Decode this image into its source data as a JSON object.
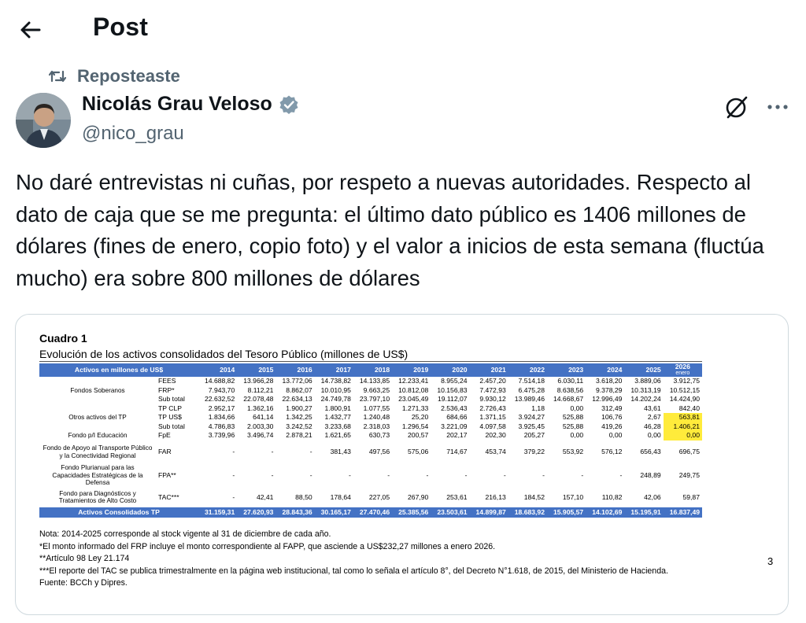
{
  "header": {
    "title": "Post"
  },
  "repost": {
    "label": "Reposteaste"
  },
  "author": {
    "name": "Nicolás Grau Veloso",
    "handle": "@nico_grau"
  },
  "tweet": {
    "text": "No daré entrevistas ni cuñas, por respeto a nuevas autoridades. Respecto al dato de caja que se me pregunta: el último dato público es 1406 millones de dólares (fines de enero, copio foto) y el valor a inicios de esta semana (fluctúa mucho) era sobre 800 millones de dólares"
  },
  "colors": {
    "accent": "#1d9bf0",
    "table_header": "#4472c4",
    "highlight": "#ffeb3b",
    "muted": "#536471"
  },
  "icons": [
    "back-arrow-icon",
    "repost-icon",
    "verified-badge-icon",
    "grok-icon",
    "more-icon"
  ],
  "document": {
    "title": "Cuadro 1",
    "subtitle": "Evolución de los activos consolidados del Tesoro Público (millones de US$)",
    "table": {
      "header_label": "Activos en millones de US$",
      "years": [
        "2014",
        "2015",
        "2016",
        "2017",
        "2018",
        "2019",
        "2020",
        "2021",
        "2022",
        "2023",
        "2024",
        "2025",
        "2026"
      ],
      "last_col_sub": "enero",
      "rows": [
        {
          "group": "Fondos Soberanos",
          "item": "FEES",
          "values": [
            "14.688,82",
            "13.966,28",
            "13.772,06",
            "14.738,82",
            "14.133,85",
            "12.233,41",
            "8.955,24",
            "2.457,20",
            "7.514,18",
            "6.030,11",
            "3.618,20",
            "3.889,06",
            "3.912,75"
          ]
        },
        {
          "group": "",
          "item": "FRP*",
          "values": [
            "7.943,70",
            "8.112,21",
            "8.862,07",
            "10.010,95",
            "9.663,25",
            "10.812,08",
            "10.156,83",
            "7.472,93",
            "6.475,28",
            "8.638,56",
            "9.378,29",
            "10.313,19",
            "10.512,15"
          ]
        },
        {
          "group": "",
          "item": "Sub total",
          "values": [
            "22.632,52",
            "22.078,48",
            "22.634,13",
            "24.749,78",
            "23.797,10",
            "23.045,49",
            "19.112,07",
            "9.930,12",
            "13.989,46",
            "14.668,67",
            "12.996,49",
            "14.202,24",
            "14.424,90"
          ]
        },
        {
          "group": "Otros activos del TP",
          "item": "TP CLP",
          "values": [
            "2.952,17",
            "1.362,16",
            "1.900,27",
            "1.800,91",
            "1.077,55",
            "1.271,33",
            "2.536,43",
            "2.726,43",
            "1,18",
            "0,00",
            "312,49",
            "43,61",
            "842,40"
          ]
        },
        {
          "group": "",
          "item": "TP US$",
          "values": [
            "1.834,66",
            "641,14",
            "1.342,25",
            "1.432,77",
            "1.240,48",
            "25,20",
            "684,66",
            "1.371,15",
            "3.924,27",
            "525,88",
            "106,76",
            "2,67",
            "563,81"
          ]
        },
        {
          "group": "",
          "item": "Sub total",
          "values": [
            "4.786,83",
            "2.003,30",
            "3.242,52",
            "3.233,68",
            "2.318,03",
            "1.296,54",
            "3.221,09",
            "4.097,58",
            "3.925,45",
            "525,88",
            "419,26",
            "46,28",
            "1.406,21"
          ]
        },
        {
          "group": "Fondo p/I Educación",
          "item": "FpE",
          "values": [
            "3.739,96",
            "3.496,74",
            "2.878,21",
            "1.621,65",
            "630,73",
            "200,57",
            "202,17",
            "202,30",
            "205,27",
            "0,00",
            "0,00",
            "0,00",
            "0,00"
          ]
        },
        {
          "group": "Fondo de Apoyo al Transporte Público y la Conectividad Regional",
          "item": "FAR",
          "values": [
            "-",
            "-",
            "-",
            "381,43",
            "497,56",
            "575,06",
            "714,67",
            "453,74",
            "379,22",
            "553,92",
            "576,12",
            "656,43",
            "696,75"
          ]
        },
        {
          "group": "Fondo Plurianual para las Capacidades Estratégicas de la Defensa",
          "item": "FPA**",
          "values": [
            "-",
            "-",
            "-",
            "-",
            "-",
            "-",
            "-",
            "-",
            "-",
            "-",
            "-",
            "248,89",
            "249,75"
          ]
        },
        {
          "group": "Fondo para Diagnósticos y Tratamientos de Alto Costo",
          "item": "TAC***",
          "values": [
            "-",
            "42,41",
            "88,50",
            "178,64",
            "227,05",
            "267,90",
            "253,61",
            "216,13",
            "184,52",
            "157,10",
            "110,82",
            "42,06",
            "59,87"
          ]
        }
      ],
      "total": {
        "label": "Activos Consolidados TP",
        "values": [
          "31.159,31",
          "27.620,93",
          "28.843,36",
          "30.165,17",
          "27.470,46",
          "25.385,56",
          "23.503,61",
          "14.899,87",
          "18.683,92",
          "15.905,57",
          "14.102,69",
          "15.195,91",
          "16.837,49"
        ]
      }
    },
    "notes": [
      "Nota: 2014-2025 corresponde al stock vigente al 31 de diciembre de cada año.",
      "*El monto informado del FRP incluye el monto correspondiente al FAPP, que asciende a US$232,27 millones a enero 2026.",
      "**Artículo 98 Ley 21.174",
      "***El reporte del TAC se publica trimestralmente en la página web institucional, tal como lo señala el artículo 8°, del Decreto N°1.618, de 2015, del Ministerio de Hacienda.",
      "Fuente: BCCh y Dipres."
    ],
    "page_number": "3"
  }
}
